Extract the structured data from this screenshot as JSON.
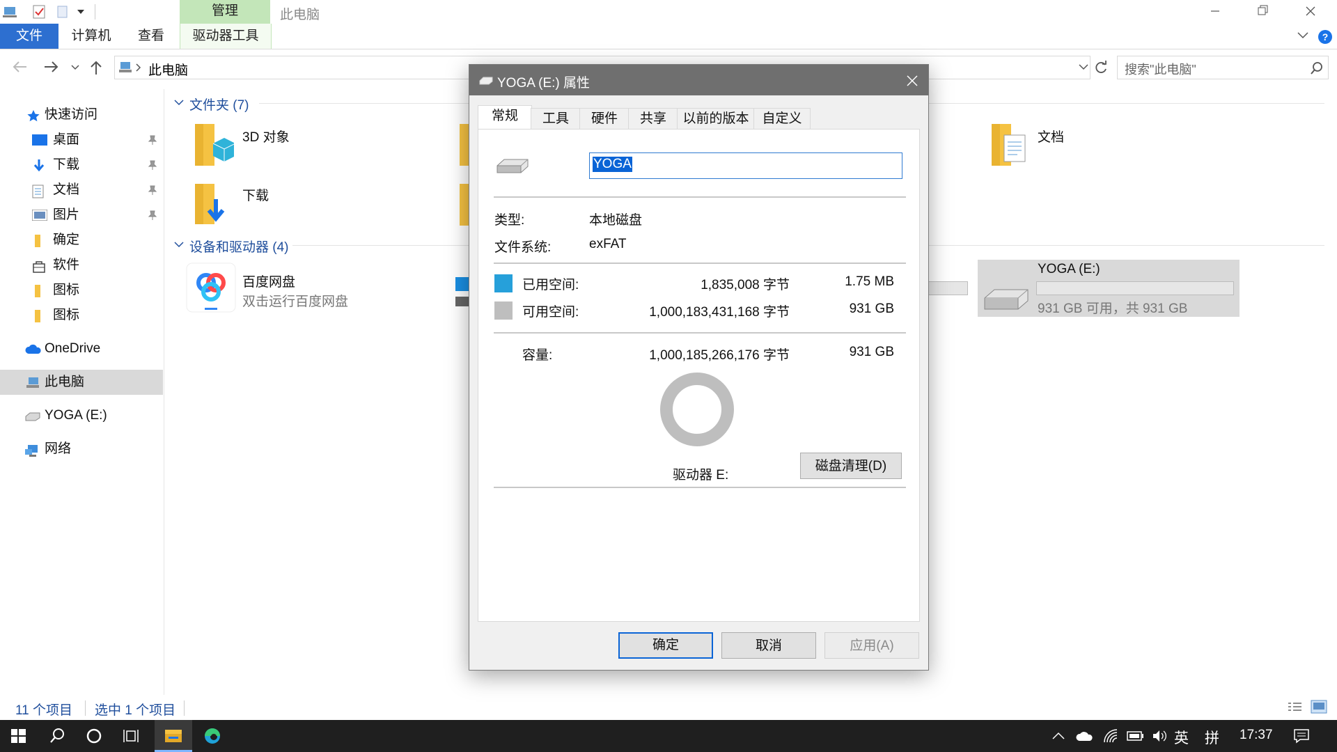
{
  "window": {
    "title": "此电脑"
  },
  "ribbon": {
    "manage_label": "管理",
    "tabs": [
      "文件",
      "计算机",
      "查看",
      "驱动器工具"
    ]
  },
  "address": {
    "crumb": "此电脑",
    "search_placeholder": "搜索\"此电脑\""
  },
  "nav": {
    "quick_access": "快速访问",
    "items": [
      "桌面",
      "下载",
      "文档",
      "图片",
      "确定",
      "软件",
      "图标",
      "图标"
    ],
    "onedrive": "OneDrive",
    "this_pc": "此电脑",
    "yoga": "YOGA (E:)",
    "network": "网络"
  },
  "content": {
    "folders_header": "文件夹 (7)",
    "folders": [
      "3D 对象",
      "下载",
      "文档"
    ],
    "drives_header": "设备和驱动器 (4)",
    "baidu_name": "百度网盘",
    "baidu_sub": "双击运行百度网盘",
    "yoga_name": "YOGA (E:)",
    "yoga_sub": "931 GB 可用，共 931 GB"
  },
  "status": {
    "count": "11 个项目",
    "selected": "选中 1 个项目"
  },
  "taskbar": {
    "time": "17:37",
    "ime1": "英",
    "ime2": "拼"
  },
  "dialog": {
    "title": "YOGA (E:) 属性",
    "tabs": [
      "常规",
      "工具",
      "硬件",
      "共享",
      "以前的版本",
      "自定义"
    ],
    "name_value": "YOGA",
    "type_label": "类型:",
    "type_value": "本地磁盘",
    "fs_label": "文件系统:",
    "fs_value": "exFAT",
    "used_label": "已用空间:",
    "used_bytes": "1,835,008 字节",
    "used_size": "1.75 MB",
    "free_label": "可用空间:",
    "free_bytes": "1,000,183,431,168 字节",
    "free_size": "931 GB",
    "cap_label": "容量:",
    "cap_bytes": "1,000,185,266,176 字节",
    "cap_size": "931 GB",
    "drive_label": "驱动器 E:",
    "cleanup_label": "磁盘清理(D)",
    "ok_label": "确定",
    "cancel_label": "取消",
    "apply_label": "应用(A)",
    "used_fraction": 1.8e-06,
    "colors": {
      "used": "#26a0da",
      "free": "#bebebe"
    }
  }
}
